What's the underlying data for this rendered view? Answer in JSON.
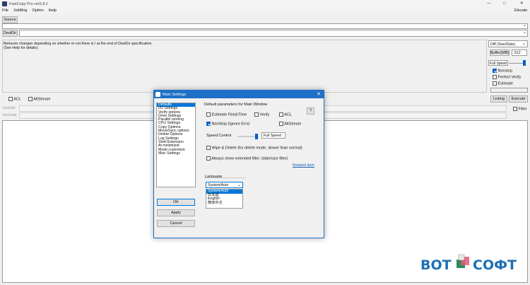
{
  "app": {
    "title": "FastCopy Pro ver5.8.1",
    "window_controls": [
      "—",
      "□",
      "✕"
    ],
    "elevate_label": "Elevate"
  },
  "menu": [
    "File",
    "JobMng",
    "Option",
    "Help"
  ],
  "source": {
    "label": "Source",
    "value": ""
  },
  "destdir": {
    "label": "DestDir",
    "value": ""
  },
  "info_text": [
    "Behavior changes depending on whether or not there is \\ at the end of DestDir specification.",
    "(See Help for details)"
  ],
  "right_panel": {
    "mode": "Diff (Size/Date)",
    "buffer_label": "Buffer(MB)",
    "buffer_value": "512",
    "speed_label": "Full Speed",
    "nonstop": "Nonstop",
    "perfect_verify": "Perfect Verify",
    "estimate": "Estimate",
    "listing": "Listing",
    "execute": "Execute",
    "filter": "Filter"
  },
  "options_row": {
    "acl": "ACL",
    "altstream": "AltStream"
  },
  "filters": {
    "include": "Include",
    "exclude": "Exclude"
  },
  "dialog": {
    "title": "Main Settings",
    "categories": [
      "Defaults",
      "I/O Settings",
      "Verify options",
      "Drive Settings",
      "Parallel running",
      "CPU Settings",
      "Copy Options",
      "Move/Sync options",
      "Delete Options",
      "Log Settings",
      "Shell Extension",
      "At minimized",
      "Mode customize",
      "Misc Settings"
    ],
    "section_title": "Default parameters for Main Window",
    "help_btn": "?",
    "estimate": "Estimate FinishTime",
    "verify": "Verify",
    "acl": "ACL",
    "nonstop": "NonStop (Ignore Errs)",
    "altstream": "AltStream",
    "speed_label": "Speed Control",
    "speed_value": "Full Speed",
    "wipe": "Wipe & Delete (for delete mode. slower than normal)",
    "ext_filter": "Always show extended filter. (date/size filter)",
    "related": "Related item",
    "language_label": "Language",
    "language_selected": "System/Auto",
    "language_options": [
      "System/Auto",
      "日本語",
      "English",
      "簡体中文"
    ],
    "ok": "OK",
    "apply": "Apply",
    "cancel": "Cancel"
  },
  "watermark": {
    "left": "BOT",
    "right": "СОФТ",
    "color": "#1f6fb5"
  }
}
